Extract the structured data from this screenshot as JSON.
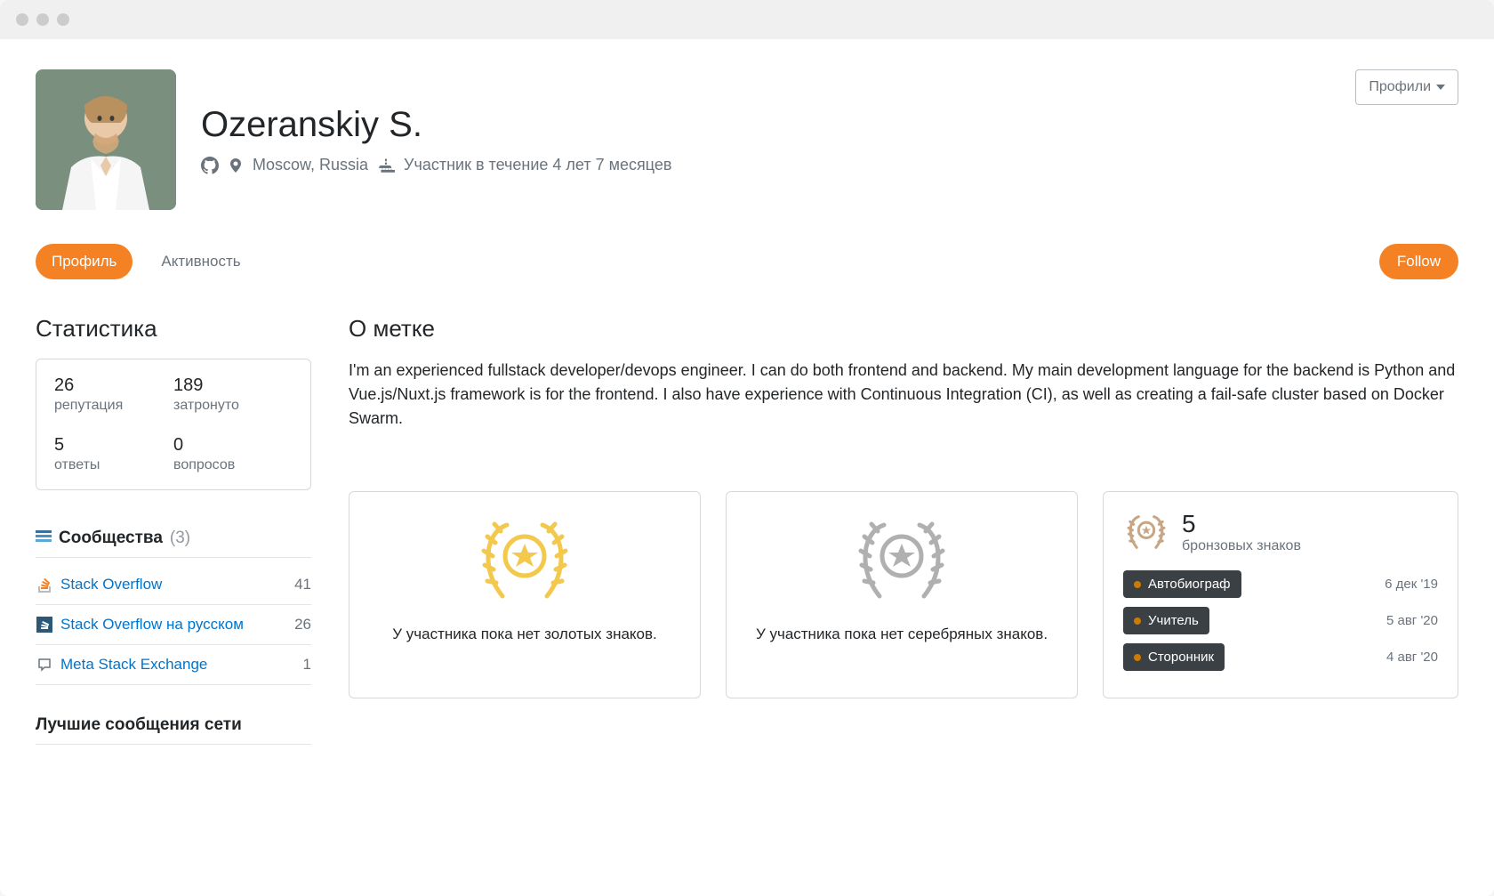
{
  "user": {
    "name": "Ozeranskiy S.",
    "location": "Moscow, Russia",
    "membership": "Участник в течение 4 лет 7 месяцев"
  },
  "buttons": {
    "profiles": "Профили",
    "follow": "Follow"
  },
  "tabs": {
    "profile": "Профиль",
    "activity": "Активность"
  },
  "stats": {
    "title": "Статистика",
    "reputation": {
      "value": "26",
      "label": "репутация"
    },
    "reached": {
      "value": "189",
      "label": "затронуто"
    },
    "answers": {
      "value": "5",
      "label": "ответы"
    },
    "questions": {
      "value": "0",
      "label": "вопросов"
    }
  },
  "communities": {
    "title": "Сообщества",
    "count": "(3)",
    "items": [
      {
        "name": "Stack Overflow",
        "rep": "41"
      },
      {
        "name": "Stack Overflow на русском",
        "rep": "26"
      },
      {
        "name": "Meta Stack Exchange",
        "rep": "1"
      }
    ]
  },
  "network": {
    "title": "Лучшие сообщения сети"
  },
  "about": {
    "title": "О метке",
    "text": "I'm an experienced fullstack developer/devops engineer. I can do both frontend and backend. My main development language for the backend is Python and Vue.js/Nuxt.js framework is for the frontend. I also have experience with Continuous Integration (CI), as well as creating a fail-safe cluster based on Docker Swarm."
  },
  "badges": {
    "gold_empty": "У участника пока нет золотых знаков.",
    "silver_empty": "У участника пока нет серебряных знаков.",
    "bronze": {
      "count": "5",
      "label": "бронзовых знаков",
      "items": [
        {
          "name": "Автобиограф",
          "date": "6 дек '19"
        },
        {
          "name": "Учитель",
          "date": "5 авг '20"
        },
        {
          "name": "Сторонник",
          "date": "4 авг '20"
        }
      ]
    }
  }
}
